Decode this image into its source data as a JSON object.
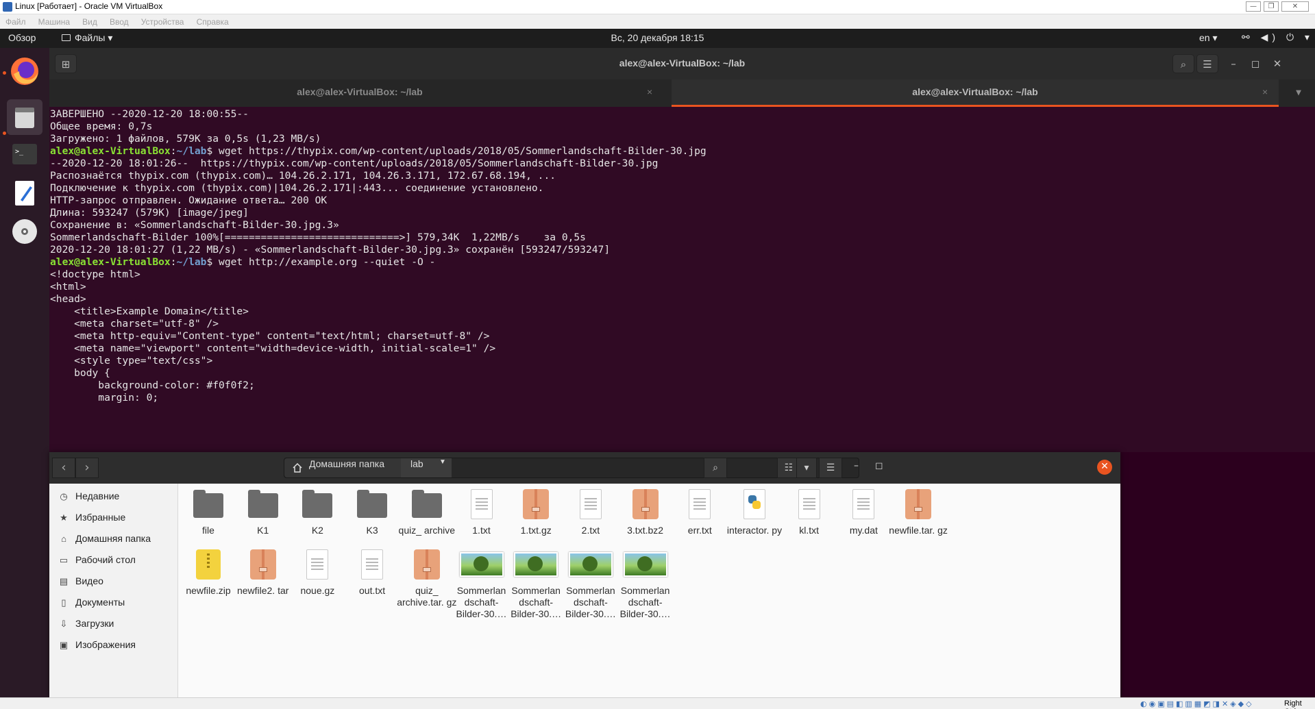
{
  "vbox": {
    "title": "Linux [Работает] - Oracle VM VirtualBox",
    "menu": [
      "Файл",
      "Машина",
      "Вид",
      "Ввод",
      "Устройства",
      "Справка"
    ],
    "status_host_key": "Right Ctrl"
  },
  "topbar": {
    "activities": "Обзор",
    "app_menu": "Файлы ▾",
    "clock": "Вс, 20 декабря  18:15",
    "lang": "en ▾",
    "sys_icons": "⚯ ◀) ⏻ ▾"
  },
  "terminal": {
    "title": "alex@alex-VirtualBox: ~/lab",
    "tabs": [
      {
        "label": "alex@alex-VirtualBox: ~/lab"
      },
      {
        "label": "alex@alex-VirtualBox: ~/lab"
      }
    ],
    "prompt_user": "alex@alex-VirtualBox",
    "prompt_path": "~/lab",
    "lines": [
      {
        "text": "ЗАВЕРШЕНО --2020-12-20 18:00:55--"
      },
      {
        "text": "Общее время: 0,7s"
      },
      {
        "text": "Загружено: 1 файлов, 579K за 0,5s (1,23 MB/s)"
      },
      {
        "prompt": true,
        "cmd": "$ wget https://thypix.com/wp-content/uploads/2018/05/Sommerlandschaft-Bilder-30.jpg"
      },
      {
        "text": "--2020-12-20 18:01:26--  https://thypix.com/wp-content/uploads/2018/05/Sommerlandschaft-Bilder-30.jpg"
      },
      {
        "text": "Распознаётся thypix.com (thypix.com)… 104.26.2.171, 104.26.3.171, 172.67.68.194, ..."
      },
      {
        "text": "Подключение к thypix.com (thypix.com)|104.26.2.171|:443... соединение установлено."
      },
      {
        "text": "HTTP-запрос отправлен. Ожидание ответа… 200 OK"
      },
      {
        "text": "Длина: 593247 (579K) [image/jpeg]"
      },
      {
        "text": "Сохранение в: «Sommerlandschaft-Bilder-30.jpg.3»"
      },
      {
        "text": ""
      },
      {
        "text": "Sommerlandschaft-Bilder 100%[=============================>] 579,34K  1,22MB/s    за 0,5s"
      },
      {
        "text": ""
      },
      {
        "text": "2020-12-20 18:01:27 (1,22 MB/s) - «Sommerlandschaft-Bilder-30.jpg.3» сохранён [593247/593247]"
      },
      {
        "text": ""
      },
      {
        "prompt": true,
        "cmd": "$ wget http://example.org --quiet -O -"
      },
      {
        "text": "<!doctype html>"
      },
      {
        "text": "<html>"
      },
      {
        "text": "<head>"
      },
      {
        "text": "    <title>Example Domain</title>"
      },
      {
        "text": ""
      },
      {
        "text": "    <meta charset=\"utf-8\" />"
      },
      {
        "text": "    <meta http-equiv=\"Content-type\" content=\"text/html; charset=utf-8\" />"
      },
      {
        "text": "    <meta name=\"viewport\" content=\"width=device-width, initial-scale=1\" />"
      },
      {
        "text": "    <style type=\"text/css\">"
      },
      {
        "text": "    body {"
      },
      {
        "text": "        background-color: #f0f0f2;"
      },
      {
        "text": "        margin: 0;"
      }
    ]
  },
  "files": {
    "path_home": "Домашняя папка",
    "path_current": "lab",
    "sidebar": [
      {
        "label": "Недавние",
        "icon": "clock-icon"
      },
      {
        "label": "Избранные",
        "icon": "star-icon"
      },
      {
        "label": "Домашняя папка",
        "icon": "home-icon"
      },
      {
        "label": "Рабочий стол",
        "icon": "desktop-icon"
      },
      {
        "label": "Видео",
        "icon": "video-icon"
      },
      {
        "label": "Документы",
        "icon": "documents-icon"
      },
      {
        "label": "Загрузки",
        "icon": "downloads-icon"
      },
      {
        "label": "Изображения",
        "icon": "pictures-icon"
      }
    ],
    "items": [
      {
        "name": "file",
        "kind": "folder"
      },
      {
        "name": "K1",
        "kind": "folder"
      },
      {
        "name": "K2",
        "kind": "folder"
      },
      {
        "name": "K3",
        "kind": "folder"
      },
      {
        "name": "quiz_ archive",
        "kind": "folder"
      },
      {
        "name": "1.txt",
        "kind": "text"
      },
      {
        "name": "1.txt.gz",
        "kind": "archive"
      },
      {
        "name": "2.txt",
        "kind": "text"
      },
      {
        "name": "3.txt.bz2",
        "kind": "archive"
      },
      {
        "name": "err.txt",
        "kind": "text"
      },
      {
        "name": "interactor. py",
        "kind": "python"
      },
      {
        "name": "kl.txt",
        "kind": "text"
      },
      {
        "name": "my.dat",
        "kind": "text"
      },
      {
        "name": "newfile.tar. gz",
        "kind": "archive"
      },
      {
        "name": "newfile.zip",
        "kind": "zip"
      },
      {
        "name": "newfile2. tar",
        "kind": "archive"
      },
      {
        "name": "noue.gz",
        "kind": "text"
      },
      {
        "name": "out.txt",
        "kind": "text"
      },
      {
        "name": "quiz_ archive.tar. gz",
        "kind": "archive"
      },
      {
        "name": "Sommerlan dschaft- Bilder-30.…",
        "kind": "image"
      },
      {
        "name": "Sommerlan dschaft- Bilder-30.…",
        "kind": "image"
      },
      {
        "name": "Sommerlan dschaft- Bilder-30.…",
        "kind": "image"
      },
      {
        "name": "Sommerlan dschaft- Bilder-30.…",
        "kind": "image"
      }
    ]
  }
}
